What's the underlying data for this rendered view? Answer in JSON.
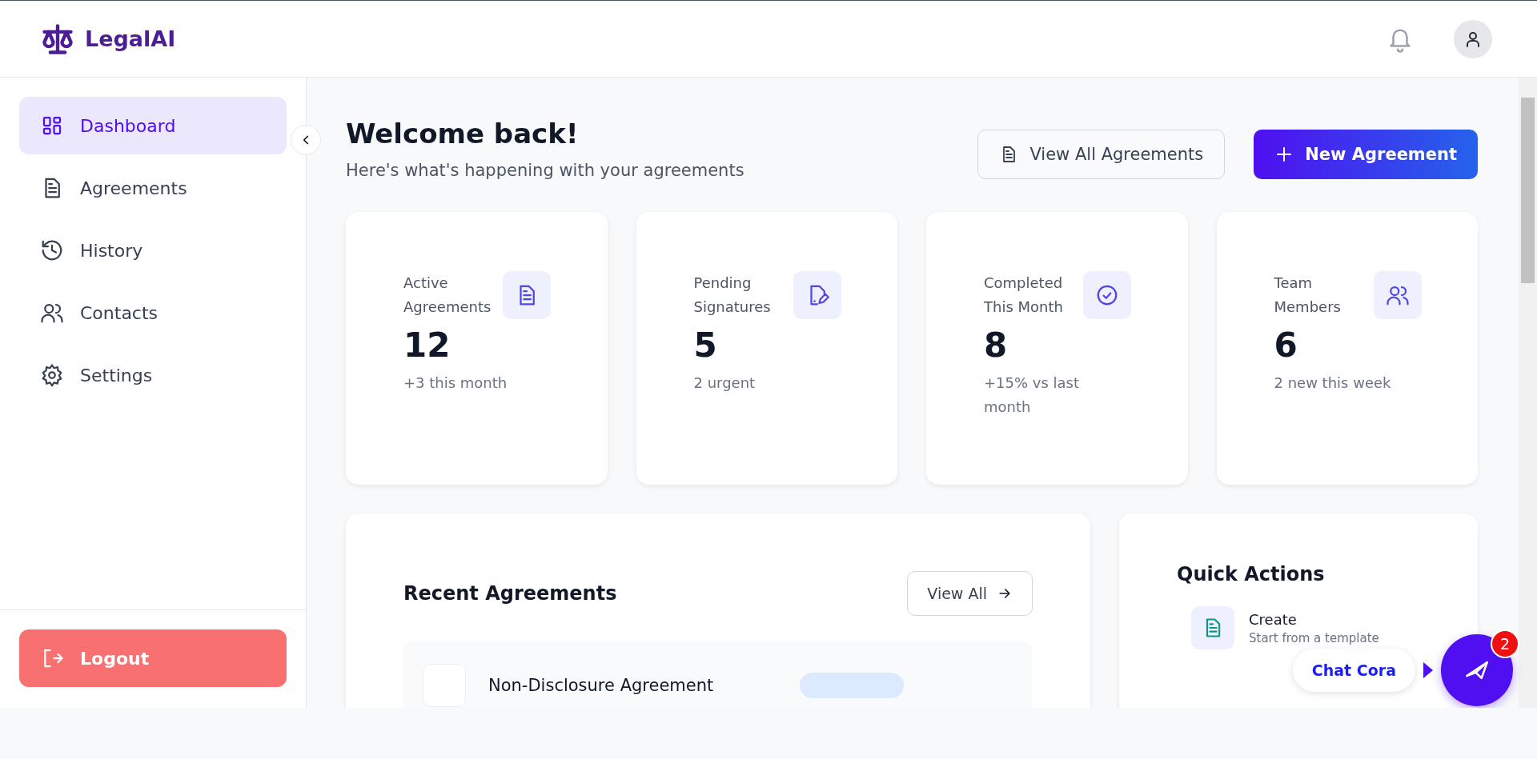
{
  "brand": {
    "name": "LegalAI"
  },
  "sidebar": {
    "items": [
      {
        "label": "Dashboard",
        "selected": true
      },
      {
        "label": "Agreements",
        "selected": false
      },
      {
        "label": "History",
        "selected": false
      },
      {
        "label": "Contacts",
        "selected": false
      },
      {
        "label": "Settings",
        "selected": false
      }
    ],
    "logout": "Logout"
  },
  "page": {
    "title": "Welcome back!",
    "subtitle": "Here's what's happening with your agreements",
    "actions": [
      {
        "label": "View All Agreements",
        "kind": "secondary"
      },
      {
        "label": "New Agreement",
        "kind": "primary"
      }
    ]
  },
  "stats": [
    {
      "label": "Active Agreements",
      "value": "12",
      "note": "+3 this month"
    },
    {
      "label": "Pending Signatures",
      "value": "5",
      "note": "2 urgent"
    },
    {
      "label": "Completed This Month",
      "value": "8",
      "note": "+15% vs last month"
    },
    {
      "label": "Team Members",
      "value": "6",
      "note": "2 new this week"
    }
  ],
  "recent": {
    "title": "Recent Agreements",
    "view_all": "View All",
    "rows": [
      {
        "title": "Non-Disclosure Agreement"
      }
    ]
  },
  "quick_actions": {
    "title": "Quick Actions",
    "items": [
      {
        "title": "Create",
        "subtitle": "Start from a template"
      }
    ]
  },
  "chat": {
    "label": "Chat Cora",
    "badge": "2"
  }
}
